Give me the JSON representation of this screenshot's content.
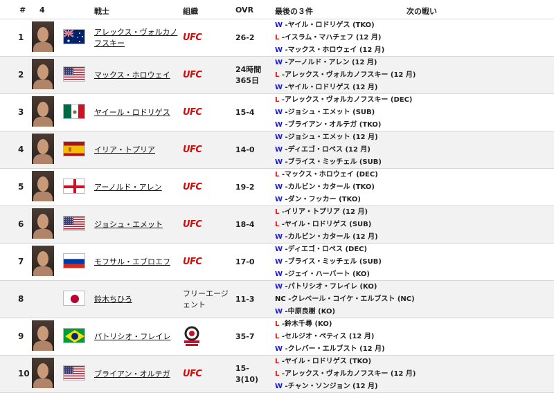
{
  "header": {
    "num": "#",
    "count": "4",
    "fighter": "戦士",
    "org": "組織",
    "ovr": "OVR",
    "last3": "最後の３件",
    "next": "次の戦い"
  },
  "rows": [
    {
      "rank": "1",
      "flag": "australia",
      "name": "アレックス・ヴォルカノフスキー",
      "org": "UFC",
      "ovr": "26-2",
      "fights": [
        {
          "r": "W",
          "t": "-ヤイル・ロドリゲス (TKO)"
        },
        {
          "r": "L",
          "t": "-イスラム・マハチェフ (12 月)"
        },
        {
          "r": "W",
          "t": "-マックス・ホロウェイ (12 月)"
        }
      ]
    },
    {
      "rank": "2",
      "flag": "usa",
      "name": "マックス・ホロウェイ",
      "org": "UFC",
      "ovr": "24時間365日",
      "fights": [
        {
          "r": "W",
          "t": "-アーノルド・アレン (12 月)"
        },
        {
          "r": "L",
          "t": "-アレックス・ヴォルカノフスキー (12 月)"
        },
        {
          "r": "W",
          "t": "-ヤイル・ロドリゲス (12 月)"
        }
      ]
    },
    {
      "rank": "3",
      "flag": "mexico",
      "name": "ヤイール・ロドリゲス",
      "org": "UFC",
      "ovr": "15-4",
      "fights": [
        {
          "r": "L",
          "t": "-アレックス・ヴォルカノフスキー (DEC)"
        },
        {
          "r": "W",
          "t": "-ジョシュ・エメット (SUB)"
        },
        {
          "r": "W",
          "t": "-ブライアン・オルテガ (TKO)"
        }
      ]
    },
    {
      "rank": "4",
      "flag": "spain",
      "name": "イリア・トプリア",
      "org": "UFC",
      "ovr": "14-0",
      "fights": [
        {
          "r": "W",
          "t": "-ジョシュ・エメット (12 月)"
        },
        {
          "r": "W",
          "t": "-ディエゴ・ロペス (12 月)"
        },
        {
          "r": "W",
          "t": "-ブライス・ミッチェル (SUB)"
        }
      ]
    },
    {
      "rank": "5",
      "flag": "england",
      "name": "アーノルド・アレン",
      "org": "UFC",
      "ovr": "19-2",
      "fights": [
        {
          "r": "L",
          "t": "-マックス・ホロウェイ (DEC)"
        },
        {
          "r": "W",
          "t": "-カルビン・カタール (TKO)"
        },
        {
          "r": "W",
          "t": "-ダン・フッカー (TKO)"
        }
      ]
    },
    {
      "rank": "6",
      "flag": "usa",
      "name": "ジョシュ・エメット",
      "org": "UFC",
      "ovr": "18-4",
      "fights": [
        {
          "r": "L",
          "t": "-イリア・トプリア (12 月)"
        },
        {
          "r": "L",
          "t": "-ヤイル・ロドリゲス (SUB)"
        },
        {
          "r": "W",
          "t": "-カルビン・カタール (12 月)"
        }
      ]
    },
    {
      "rank": "7",
      "flag": "russia",
      "name": "モフサル・エブロエフ",
      "org": "UFC",
      "ovr": "17-0",
      "fights": [
        {
          "r": "W",
          "t": "-ディエゴ・ロペス (DEC)"
        },
        {
          "r": "W",
          "t": "-ブライス・ミッチェル (SUB)"
        },
        {
          "r": "W",
          "t": "-ジェイ・ハーバート (KO)"
        }
      ]
    },
    {
      "rank": "8",
      "flag": "japan",
      "name": "鈴木ちひろ",
      "org": "フリーエージェント",
      "ovr": "11-3",
      "nophoto": true,
      "fights": [
        {
          "r": "W",
          "t": "-パトリシオ・フレイレ (KO)"
        },
        {
          "r": "NC",
          "t": "-クレベール・コイケ・エルブスト (NC)"
        },
        {
          "r": "W",
          "t": "-中原良樹 (KO)"
        }
      ]
    },
    {
      "rank": "9",
      "flag": "brazil",
      "name": "パトリシオ・フレイレ",
      "org": "BELLATOR",
      "ovr": "35-7",
      "fights": [
        {
          "r": "L",
          "t": "-鈴木千尋 (KO)"
        },
        {
          "r": "L",
          "t": "-セルジオ・ペティス (12 月)"
        },
        {
          "r": "W",
          "t": "-クレバー・エルブスト (12 月)"
        }
      ]
    },
    {
      "rank": "10",
      "flag": "usa",
      "name": "ブライアン・オルテガ",
      "org": "UFC",
      "ovr": "15-3(10)",
      "fights": [
        {
          "r": "L",
          "t": "-ヤイル・ロドリゲス (TKO)"
        },
        {
          "r": "L",
          "t": "-アレックス・ヴォルカノフスキー (12 月)"
        },
        {
          "r": "W",
          "t": "-チャン・ソンジョン (12 月)"
        }
      ]
    }
  ]
}
